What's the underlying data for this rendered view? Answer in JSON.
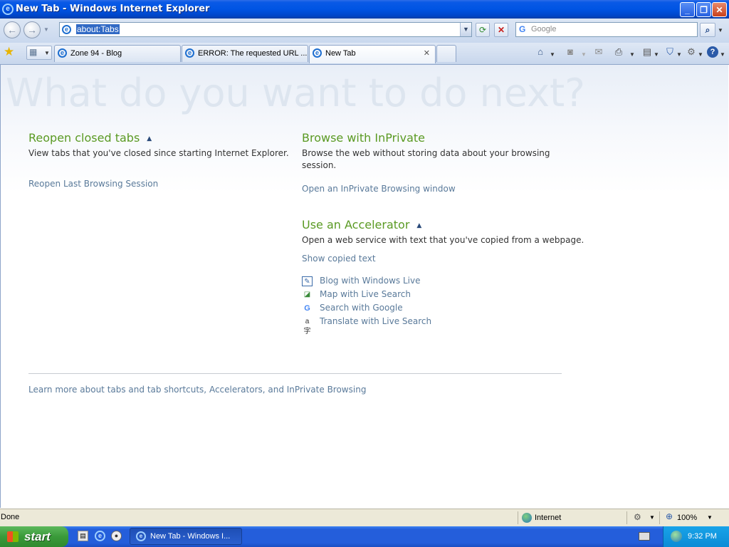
{
  "window": {
    "title": "New Tab - Windows Internet Explorer",
    "minimize_glyph": "_",
    "maximize_glyph": "❐",
    "close_glyph": "✕"
  },
  "navbar": {
    "back_glyph": "←",
    "forward_glyph": "→",
    "address": "about:Tabs",
    "refresh_glyph": "⟳",
    "stop_glyph": "✕",
    "search_placeholder": "Google",
    "search_glyph": "⌕"
  },
  "tabs": [
    {
      "label": "Zone 94 - Blog"
    },
    {
      "label": "ERROR: The requested URL ..."
    },
    {
      "label": "New Tab",
      "close_glyph": "✕"
    }
  ],
  "toolbar_icons": [
    "favorites-star-icon",
    "quick-tabs-icon",
    "home-icon",
    "feeds-icon",
    "read-mail-icon",
    "print-icon",
    "page-menu-icon",
    "safety-menu-icon",
    "tools-menu-icon",
    "help-icon"
  ],
  "content": {
    "hero": "What do you want to do next?",
    "reopen": {
      "heading": "Reopen closed tabs",
      "description": "View tabs that you've closed since starting Internet Explorer.",
      "link": "Reopen Last Browsing Session"
    },
    "inprivate": {
      "heading": "Browse with InPrivate",
      "description": "Browse the web without storing data about your browsing session.",
      "link": "Open an InPrivate Browsing window"
    },
    "accelerator": {
      "heading": "Use an Accelerator",
      "description": "Open a web service with text that you've copied from a webpage.",
      "show_link": "Show copied text",
      "items": [
        {
          "label": "Blog with Windows Live",
          "icon": "blog-icon"
        },
        {
          "label": "Map with Live Search",
          "icon": "map-icon"
        },
        {
          "label": "Search with Google",
          "icon": "google-icon"
        },
        {
          "label": "Translate with Live Search",
          "icon": "translate-icon"
        }
      ]
    },
    "footer_link": "Learn more about tabs and tab shortcuts, Accelerators, and InPrivate Browsing"
  },
  "statusbar": {
    "status": "Done",
    "zone": "Internet",
    "zoom": "100%"
  },
  "taskbar": {
    "start": "start",
    "task": "New Tab - Windows I...",
    "clock": "9:32 PM"
  },
  "colors": {
    "heading_green": "#5a9a23",
    "link_blue": "#5a7a9a",
    "titlebar_blue": "#0054e3",
    "start_green": "#3a9a3a"
  }
}
